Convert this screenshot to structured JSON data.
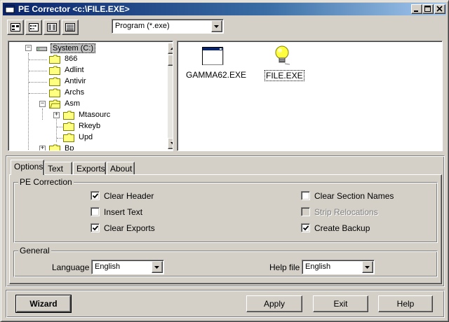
{
  "window": {
    "title": "PE Corrector <c:\\FILE.EXE>"
  },
  "toolbar": {
    "buttons": [
      "large-icons-view-icon",
      "small-icons-view-icon",
      "list-view-icon",
      "details-view-icon"
    ],
    "file_filter": "Program (*.exe)"
  },
  "tree": {
    "items": [
      {
        "label": "System (C:)",
        "selected": true
      },
      {
        "label": "866"
      },
      {
        "label": "Adlint"
      },
      {
        "label": "Antivir"
      },
      {
        "label": "Archs"
      },
      {
        "label": "Asm"
      },
      {
        "label": "Mtasourc"
      },
      {
        "label": "Rkeyb"
      },
      {
        "label": "Upd"
      },
      {
        "label": "Bp"
      }
    ]
  },
  "files": [
    {
      "name": "GAMMA62.EXE",
      "icon": "exe-window-icon"
    },
    {
      "name": "FILE.EXE",
      "icon": "lightbulb-icon",
      "selected": true
    }
  ],
  "tabs": [
    "Options",
    "Text",
    "Exports",
    "About"
  ],
  "options": {
    "group_title": "PE Correction",
    "checkboxes": [
      {
        "label": "Clear Header",
        "checked": true,
        "enabled": true
      },
      {
        "label": "Insert Text",
        "checked": false,
        "enabled": true
      },
      {
        "label": "Clear Exports",
        "checked": true,
        "enabled": true
      },
      {
        "label": "Clear Section Names",
        "checked": false,
        "enabled": true
      },
      {
        "label": "Strip Relocations",
        "checked": false,
        "enabled": false
      },
      {
        "label": "Create Backup",
        "checked": true,
        "enabled": true
      }
    ]
  },
  "general": {
    "group_title": "General",
    "language_label": "Language",
    "language_value": "English",
    "helpfile_label": "Help file",
    "helpfile_value": "English"
  },
  "buttons": {
    "wizard": "Wizard",
    "apply": "Apply",
    "exit": "Exit",
    "help": "Help"
  },
  "colors": {
    "title_start": "#0a246a",
    "title_end": "#a6caf0",
    "face": "#d4d0c8",
    "folder": "#ffff80",
    "selection": "#c0c0c0"
  }
}
